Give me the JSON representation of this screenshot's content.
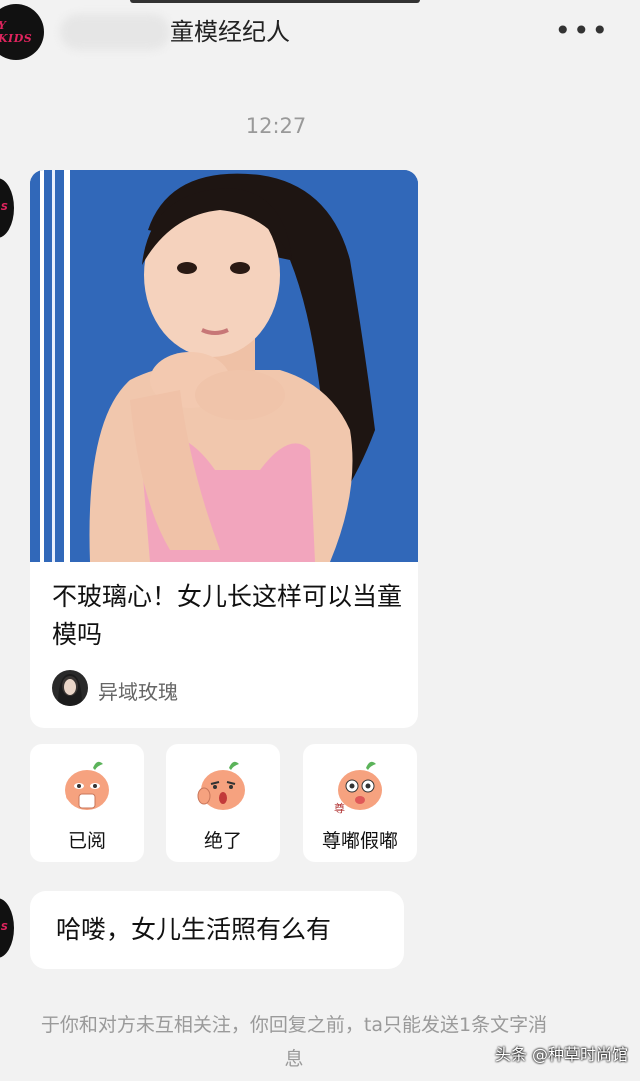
{
  "header": {
    "avatar_text": "Y KIDS",
    "title": "童模经纪人",
    "more_label": "•••"
  },
  "chat": {
    "time": "12:27",
    "card": {
      "title": "不玻璃心！女儿长这样可以当童模吗",
      "author": "异域玫瑰"
    },
    "reactions": [
      {
        "label": "已阅",
        "icon": "read-emoji-icon"
      },
      {
        "label": "绝了",
        "icon": "amazing-emoji-icon"
      },
      {
        "label": "尊嘟假嘟",
        "icon": "really-emoji-icon"
      }
    ],
    "message": "哈喽，女儿生活照有么有",
    "notice_line1": "于你和对方未互相关注，你回复之前，ta只能发送1条文字消",
    "notice_line2": "息"
  },
  "watermark": "头条 @种草时尚馆",
  "colors": {
    "background": "#f2f2f2",
    "photo_bg": "#2f63b6",
    "brand_accent": "#e0245e"
  }
}
